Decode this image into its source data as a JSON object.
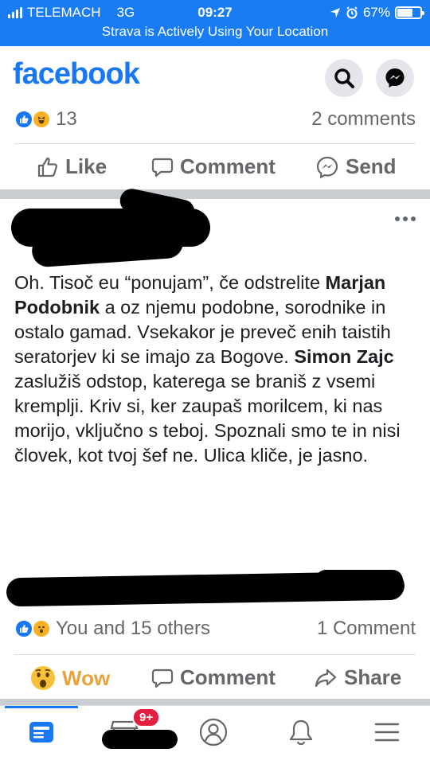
{
  "status_bar": {
    "carrier": "TELEMACH",
    "network": "3G",
    "time": "09:27",
    "battery": "67%",
    "battery_level": 0.67,
    "banner": "Strava is Actively Using Your Location"
  },
  "header": {
    "logo": "facebook",
    "search_icon": "search-icon",
    "messenger_icon": "messenger-icon"
  },
  "top_post": {
    "reaction_count": "13",
    "comments": "2 comments",
    "actions": {
      "like": "Like",
      "comment": "Comment",
      "send": "Send"
    }
  },
  "shared_post": {
    "text_parts": {
      "p1": "Oh. Tisoč eu “ponujam”, če odstrelite ",
      "mention1": "Marjan Podobnik",
      "p2": " a oz njemu podobne, sorodnike in ostalo gamad. Vsekakor je preveč enih taistih seratorjev ki se imajo za Bogove.  ",
      "mention2": "Simon Zajc",
      "p3": " zaslužiš odstop, katerega se braniš z vsemi kremplji. Kriv si, ker zaupaš morilcem, ki nas morijo, vključno s teboj. Spoznali smo te in nisi človek, kot tvoj šef ne. Ulica kliče, je jasno."
    },
    "reactions_text": "You and 15 others",
    "comments": "1 Comment",
    "actions": {
      "wow": "Wow",
      "comment": "Comment",
      "share": "Share"
    }
  },
  "bottom_nav": {
    "items": [
      "news-feed-icon",
      "marketplace-icon",
      "profile-icon",
      "notifications-icon",
      "menu-icon"
    ],
    "badge": "9+"
  },
  "colors": {
    "status_blue": "#1a7cf5",
    "brand_blue": "#1877f2",
    "wow_orange": "#e8a33a",
    "badge_red": "#e41e3f"
  }
}
